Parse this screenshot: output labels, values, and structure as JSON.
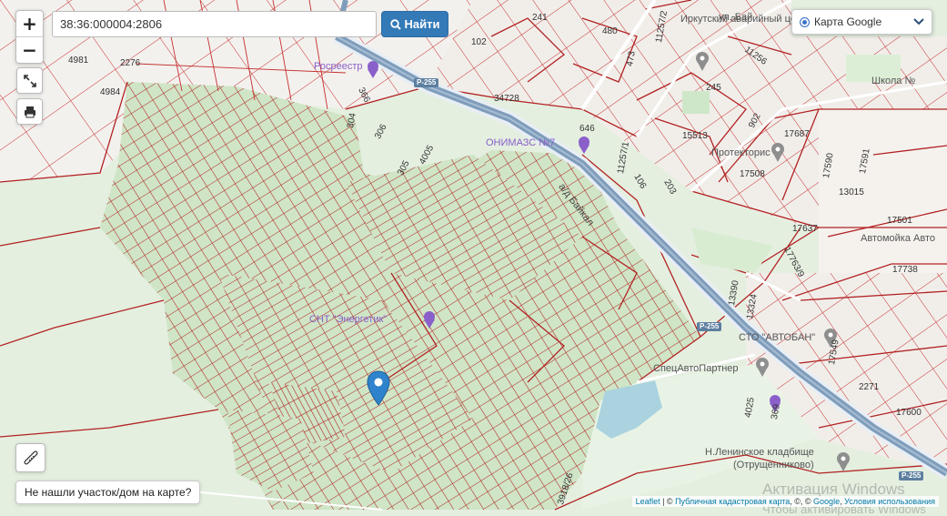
{
  "search": {
    "value": "38:36:000004:2806",
    "button_label": "Найти",
    "button_icon": "search-icon"
  },
  "controls": {
    "zoom_in": "+",
    "zoom_out": "−",
    "fullscreen_icon": "fullscreen-icon",
    "print_icon": "print-icon",
    "ruler_icon": "ruler-icon"
  },
  "layer_select": {
    "selected": "Карта Google",
    "chevron_icon": "chevron-down-icon"
  },
  "not_found_button": "Не нашли участок/дом на карте?",
  "attribution": {
    "leaflet": "Leaflet",
    "sep1": " | © ",
    "cadastral": "Публичная кадастровая карта",
    "sep2": ", ©, © ",
    "google": "Google",
    "sep3": ", ",
    "terms": "Условия использования"
  },
  "watermark": {
    "line1": "Активация Windows",
    "line2": "Чтобы активировать Windows"
  },
  "map_labels": {
    "parcels": [
      "4981",
      "2276",
      "4984",
      "241",
      "102",
      "480",
      "473",
      "34728",
      "4005",
      "305",
      "306",
      "304",
      "366",
      "646",
      "15513",
      "17687",
      "17508",
      "17590",
      "17591",
      "13015",
      "17501",
      "17637",
      "17738",
      "13390",
      "13324",
      "17549",
      "2271",
      "17600",
      "4025",
      "369",
      "106",
      "203",
      "11257/1",
      "11257/2",
      "11256",
      "245",
      "902",
      "17763/9",
      "3918/26"
    ],
    "roads": [
      "Р-255",
      "Р-255",
      "Р-255"
    ],
    "highway_name": "а/д Байкал",
    "pois": [
      "Росреестр",
      "ОНИМАЗС №7",
      "Протекторис",
      "СТО \"АВТОБАН\"",
      "СпецАвтоПартнер",
      "Н.Ленинское кладбище",
      "(Отрущенниково)",
      "Автомойка Авто",
      "СНТ \"Энергетик\"",
      "Иркутский аварийный центр",
      "Школа №",
      "ул. Бай"
    ]
  },
  "colors": {
    "parcel_border": "#b22222",
    "parcel_fill": "#c9e2c0",
    "highway": "#7f9dbb",
    "water": "#aad3df",
    "button_primary": "#337ab7"
  }
}
